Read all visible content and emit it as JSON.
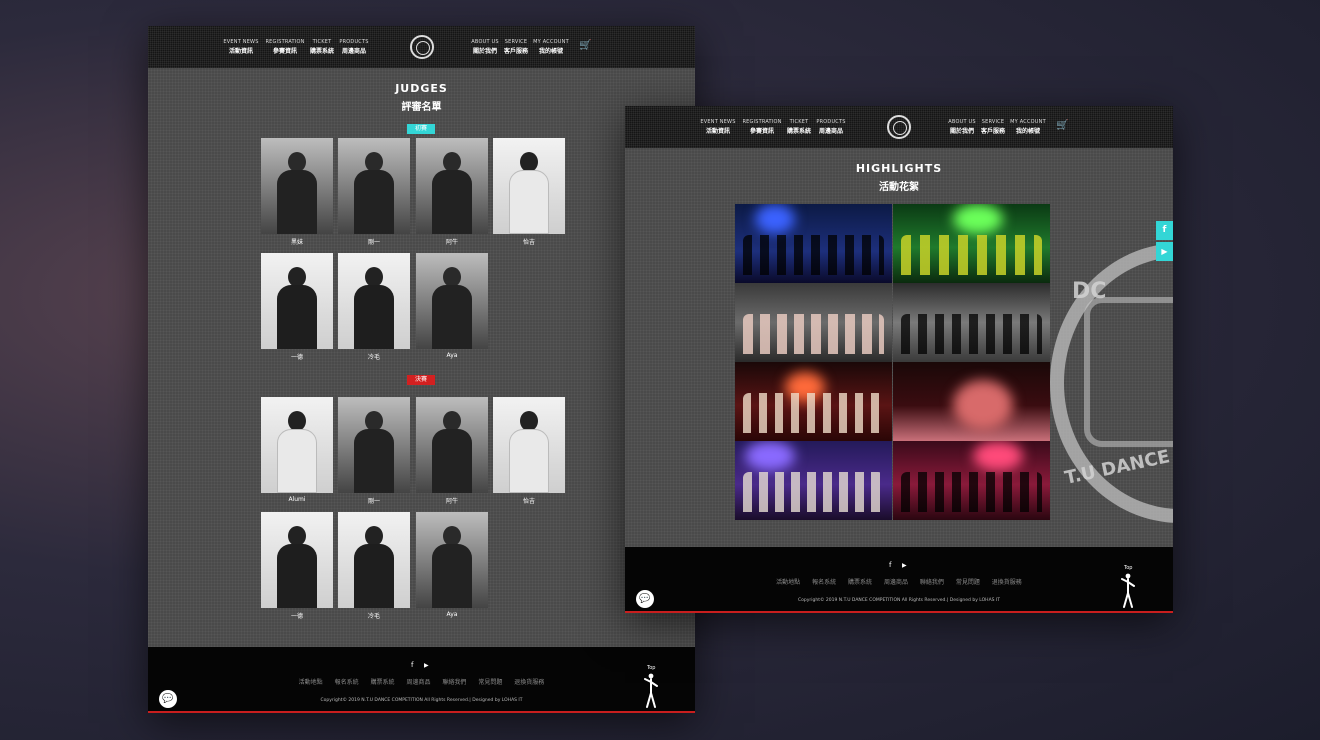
{
  "nav": {
    "left_items": [
      {
        "en": "EVENT NEWS",
        "zh": "活動資訊"
      },
      {
        "en": "REGISTRATION",
        "zh": "參賽資訊"
      },
      {
        "en": "TICKET",
        "zh": "購票系統"
      },
      {
        "en": "PRODUCTS",
        "zh": "周邊商品"
      }
    ],
    "right_items": [
      {
        "en": "ABOUT US",
        "zh": "關於我們"
      },
      {
        "en": "SERVICE",
        "zh": "客戶服務"
      },
      {
        "en": "MY ACCOUNT",
        "zh": "我的帳號"
      }
    ],
    "logo_icon": "ntu-dance-logo-icon",
    "cart_icon": "cart-icon"
  },
  "judges_page": {
    "title_en": "JUDGES",
    "title_zh": "評審名單",
    "prelim_badge": "初賽",
    "final_badge": "決賽",
    "prelim_judges": [
      "黑妹",
      "剛一",
      "阿牛",
      "怡吉",
      "一德",
      "冷毛",
      "Aya"
    ],
    "final_judges": [
      "Alumi",
      "剛一",
      "阿牛",
      "怡吉",
      "一德",
      "冷毛",
      "Aya"
    ]
  },
  "highlights_page": {
    "title_en": "HIGHLIGHTS",
    "title_zh": "活動花絮",
    "watermark_text": "DC",
    "watermark_bottom_text": "T.U DANCE"
  },
  "footer": {
    "social": [
      "f",
      "▶"
    ],
    "links": [
      "活動地點",
      "報名系統",
      "購票系統",
      "周邊商品",
      "聯絡我們",
      "常見問題",
      "退換貨服務"
    ],
    "copyright": "Copyright© 2019 N.T.U DANCE COMPETITION All Rights Reserved.| Designed by LOHAS IT",
    "top_label": "Top"
  },
  "side_buttons": [
    "f",
    "▶"
  ],
  "colors": {
    "accent_cyan": "#33d6d6",
    "accent_red": "#d32020",
    "footer_bg": "#050505"
  }
}
